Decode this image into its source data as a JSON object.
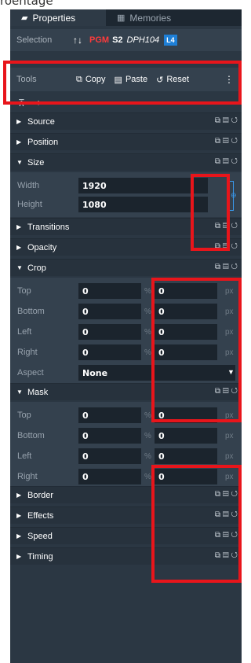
{
  "caption": "roentage",
  "tabs": [
    {
      "label": "Properties",
      "icon": "properties-icon"
    },
    {
      "label": "Memories",
      "icon": "memories-icon"
    }
  ],
  "selection": {
    "label": "Selection",
    "arrows": "↑↓",
    "pgm": "PGM",
    "s2": "S2",
    "dph": "DPH104",
    "badge": "L4"
  },
  "tools": {
    "label": "Tools",
    "copy": "Copy",
    "paste": "Paste",
    "reset": "Reset"
  },
  "sections": {
    "source": "Source",
    "position": "Position",
    "size": "Size",
    "transitions": "Transitions",
    "opacity": "Opacity",
    "crop": "Crop",
    "mask": "Mask",
    "border": "Border",
    "effects": "Effects",
    "speed": "Speed",
    "timing": "Timing"
  },
  "size": {
    "width_label": "Width",
    "width": "1920",
    "height_label": "Height",
    "height": "1080"
  },
  "crop": {
    "rows": [
      {
        "label": "Top",
        "pct": "0",
        "px": "0"
      },
      {
        "label": "Bottom",
        "pct": "0",
        "px": "0"
      },
      {
        "label": "Left",
        "pct": "0",
        "px": "0"
      },
      {
        "label": "Right",
        "pct": "0",
        "px": "0"
      }
    ],
    "aspect_label": "Aspect",
    "aspect": "None"
  },
  "mask": {
    "rows": [
      {
        "label": "Top",
        "pct": "0",
        "px": "0"
      },
      {
        "label": "Bottom",
        "pct": "0",
        "px": "0"
      },
      {
        "label": "Left",
        "pct": "0",
        "px": "0"
      },
      {
        "label": "Right",
        "pct": "0",
        "px": "0"
      }
    ]
  },
  "units": {
    "pct": "%",
    "px": "px"
  },
  "colors": {
    "panel": "#2b3743",
    "highlight": "#e8151b",
    "pgm": "#ff3b3b",
    "badge": "#1e7fd6"
  }
}
